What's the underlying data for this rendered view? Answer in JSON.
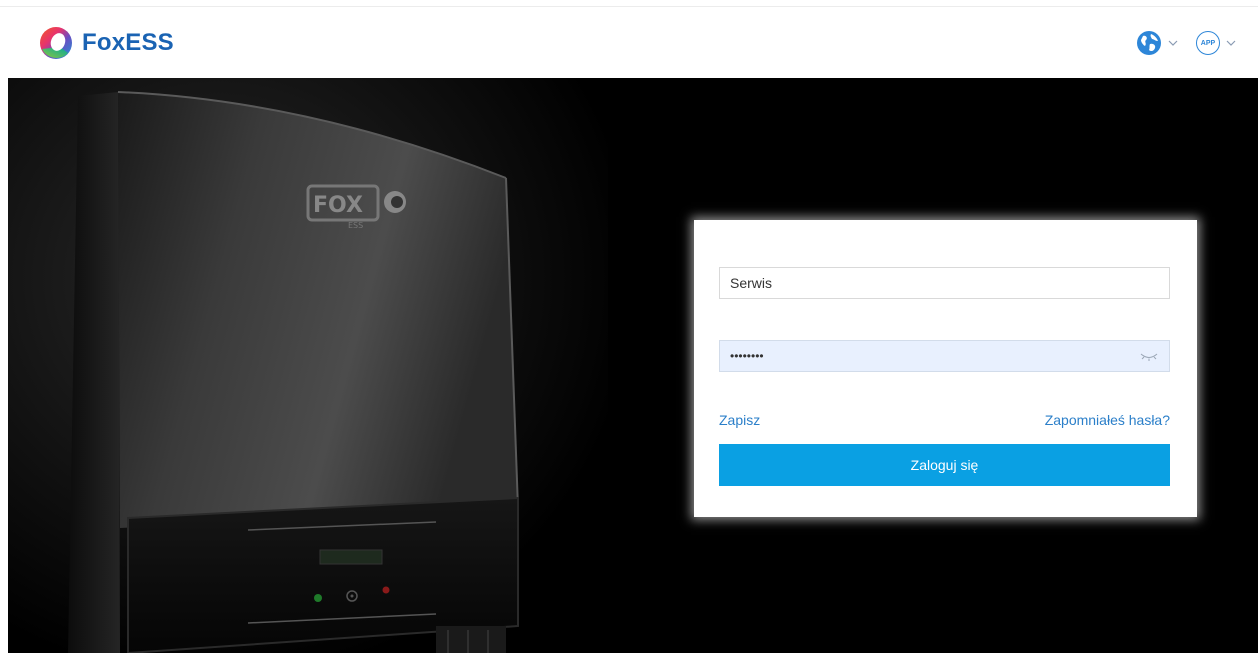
{
  "header": {
    "brand_name": "FoxESS",
    "language_icon": "globe-icon",
    "app_badge_text": "APP",
    "dropdown_icon": "chevron-down-icon"
  },
  "hero": {
    "device_brand": "FOX",
    "device_sub": "ESS"
  },
  "login": {
    "username_value": "Serwis",
    "password_mask": "••••••••",
    "remember_label": "Zapisz",
    "forgot_label": "Zapomniałeś hasła?",
    "submit_label": "Zaloguj się"
  },
  "colors": {
    "brand_blue": "#1a63b3",
    "link_blue": "#2b7fc9",
    "button_blue": "#0aa0e3",
    "autofill_bg": "#e8f0fe"
  }
}
